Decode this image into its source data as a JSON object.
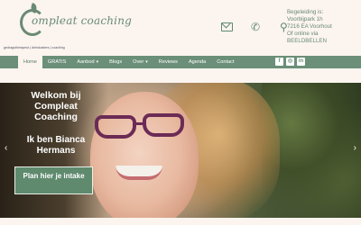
{
  "brand": {
    "logo_text": "ompleat coaching",
    "tagline": "gedragstherapeut | drieskasters | coaching"
  },
  "header": {
    "icons": [
      "envelope-icon",
      "phone-icon",
      "map-pin-icon"
    ],
    "address": {
      "line1": "Begeleiding is:",
      "line2": "Voorbijpark 1h",
      "line3": "7216 EA Voorhout",
      "line4": "Of online via",
      "line5": "BEELDBELLEN"
    }
  },
  "nav": {
    "items": [
      {
        "label": "Home",
        "active": true,
        "caret": ""
      },
      {
        "label": "GRATIS",
        "active": false,
        "caret": ""
      },
      {
        "label": "Aanbod",
        "active": false,
        "caret": "▾"
      },
      {
        "label": "Blogs",
        "active": false,
        "caret": ""
      },
      {
        "label": "Over",
        "active": false,
        "caret": "▾"
      },
      {
        "label": "Reviews",
        "active": false,
        "caret": ""
      },
      {
        "label": "Agenda",
        "active": false,
        "caret": ""
      },
      {
        "label": "Contact",
        "active": false,
        "caret": ""
      }
    ],
    "social": [
      {
        "icon": "facebook-icon",
        "glyph": "f"
      },
      {
        "icon": "instagram-icon",
        "glyph": "◎"
      },
      {
        "icon": "linkedin-icon",
        "glyph": "in"
      }
    ]
  },
  "hero": {
    "title": "Welkom bij Compleat Coaching",
    "subtitle": "Ik ben Bianca Hermans",
    "cta_label": "Plan hier je intake",
    "prev_arrow": "‹",
    "next_arrow": "›"
  },
  "colors": {
    "brand_green": "#6b8f78",
    "background": "#fbf4ef",
    "accent_purple": "#6b2b55"
  }
}
